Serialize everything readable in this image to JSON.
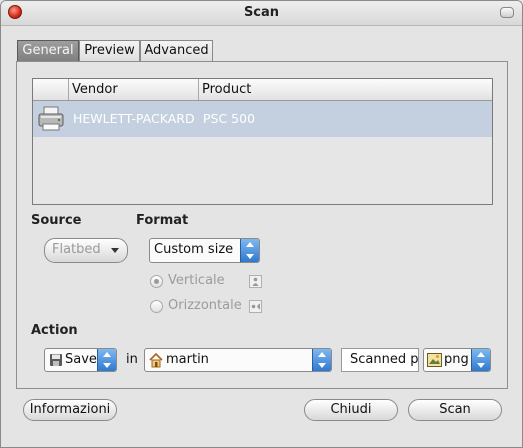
{
  "window": {
    "title": "Scan"
  },
  "tabs": [
    {
      "label": "General",
      "active": true
    },
    {
      "label": "Preview",
      "active": false
    },
    {
      "label": "Advanced",
      "active": false
    }
  ],
  "devices": {
    "columns": [
      "Vendor",
      "Product"
    ],
    "rows": [
      {
        "vendor": "HEWLETT-PACKARD",
        "product": "PSC 500",
        "icon": "printer-icon",
        "selected": true
      }
    ]
  },
  "source": {
    "label": "Source",
    "value": "Flatbed",
    "enabled": false
  },
  "format": {
    "label": "Format",
    "size": "Custom size",
    "orientation_portrait": "Verticale",
    "orientation_landscape": "Orizzontale"
  },
  "action": {
    "label": "Action",
    "verb": "Save",
    "in_label": "in",
    "folder": "martin",
    "filename": "Scanned p",
    "filetype": "png"
  },
  "buttons": {
    "info": "Informazioni",
    "close": "Chiudi",
    "scan": "Scan"
  },
  "colors": {
    "selection": "#c4d0df",
    "spin_accent": "#2f79d0",
    "close_red": "#d42a1a"
  }
}
